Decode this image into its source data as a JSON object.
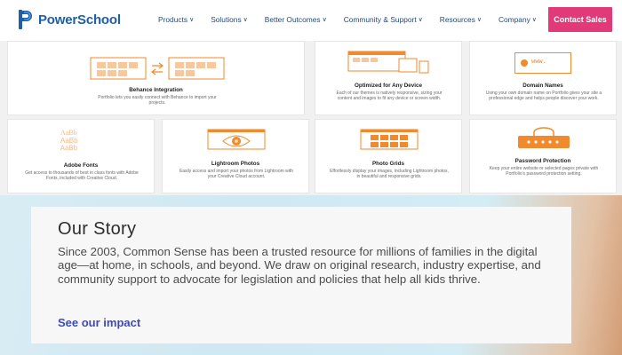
{
  "brand": {
    "name": "PowerSchool",
    "color": "#1f5fa8"
  },
  "nav": {
    "items": [
      {
        "label": "Products"
      },
      {
        "label": "Solutions"
      },
      {
        "label": "Better Outcomes"
      },
      {
        "label": "Community & Support"
      },
      {
        "label": "Resources"
      },
      {
        "label": "Company"
      }
    ],
    "cta_label": "Contact Sales",
    "cta_color": "#e23a78"
  },
  "features": [
    {
      "title": "Behance Integration",
      "desc": "Portfolio lets you easily connect with Behance to import your projects.",
      "icon": "behance-sync-icon"
    },
    {
      "title": "Optimized for Any Device",
      "desc": "Each of our themes is natively responsive, sizing your content and images to fit any device or screen width.",
      "icon": "devices-icon"
    },
    {
      "title": "Domain Names",
      "desc": "Using your own domain name on Portfolio gives your site a professional edge and helps people discover your work.",
      "icon": "domain-browser-icon"
    },
    {
      "title": "Adobe Fonts",
      "desc": "Get access to thousands of best in class fonts with Adobe Fonts, included with Creative Cloud.",
      "icon": "fonts-icon",
      "sample": "AaBb"
    },
    {
      "title": "Lightroom Photos",
      "desc": "Easily access and import your photos from Lightroom with your Creative Cloud account.",
      "icon": "lightroom-eye-icon"
    },
    {
      "title": "Photo Grids",
      "desc": "Effortlessly display your images, including Lightroom photos, in beautiful and responsive grids.",
      "icon": "photo-grid-icon"
    },
    {
      "title": "Password Protection",
      "desc": "Keep your entire website or selected pages private with Portfolio's password protection setting.",
      "icon": "password-lock-icon"
    }
  ],
  "domain_sample": "www.",
  "story": {
    "title": "Our Story",
    "body": "Since 2003, Common Sense has been a trusted resource for millions of families in the digital age—at home, in schools, and beyond. We draw on original research, industry expertise, and community support to advocate for legislation and policies that help all kids thrive.",
    "link": "See our impact",
    "link_color": "#3d4bb5"
  },
  "accent_orange": "#f08a2c"
}
